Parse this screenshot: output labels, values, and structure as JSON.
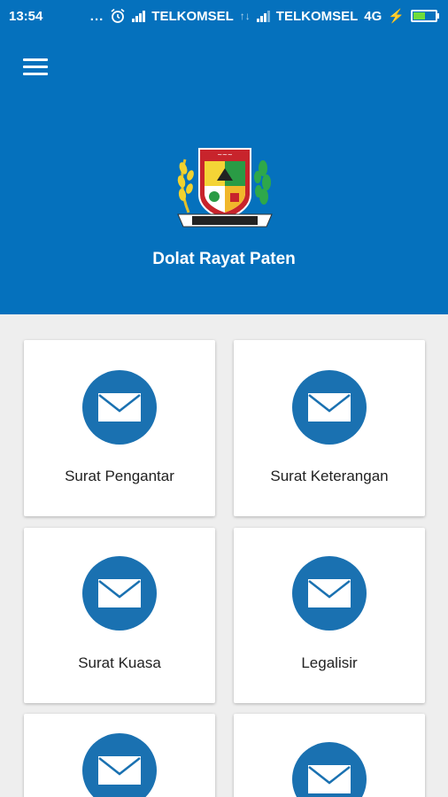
{
  "status_bar": {
    "time": "13:54",
    "dots": "...",
    "carrier1": "TELKOMSEL",
    "carrier2": "TELKOMSEL",
    "network": "4G",
    "battery_level": 0.55,
    "battery_color": "#6fdc3a"
  },
  "header": {
    "menu_icon": "hamburger-menu-icon",
    "logo": "regency-coat-of-arms-logo",
    "title": "Dolat Rayat Paten",
    "background": "#0571bd"
  },
  "menu_cards": [
    {
      "label": "Surat Pengantar",
      "icon": "envelope-icon"
    },
    {
      "label": "Surat Keterangan",
      "icon": "envelope-icon"
    },
    {
      "label": "Surat Kuasa",
      "icon": "envelope-icon"
    },
    {
      "label": "Legalisir",
      "icon": "envelope-icon"
    },
    {
      "label": "",
      "icon": "envelope-icon"
    },
    {
      "label": "",
      "icon": "envelope-icon"
    }
  ],
  "colors": {
    "accent_circle": "#1a71b1",
    "page_background": "#eeeeee"
  }
}
